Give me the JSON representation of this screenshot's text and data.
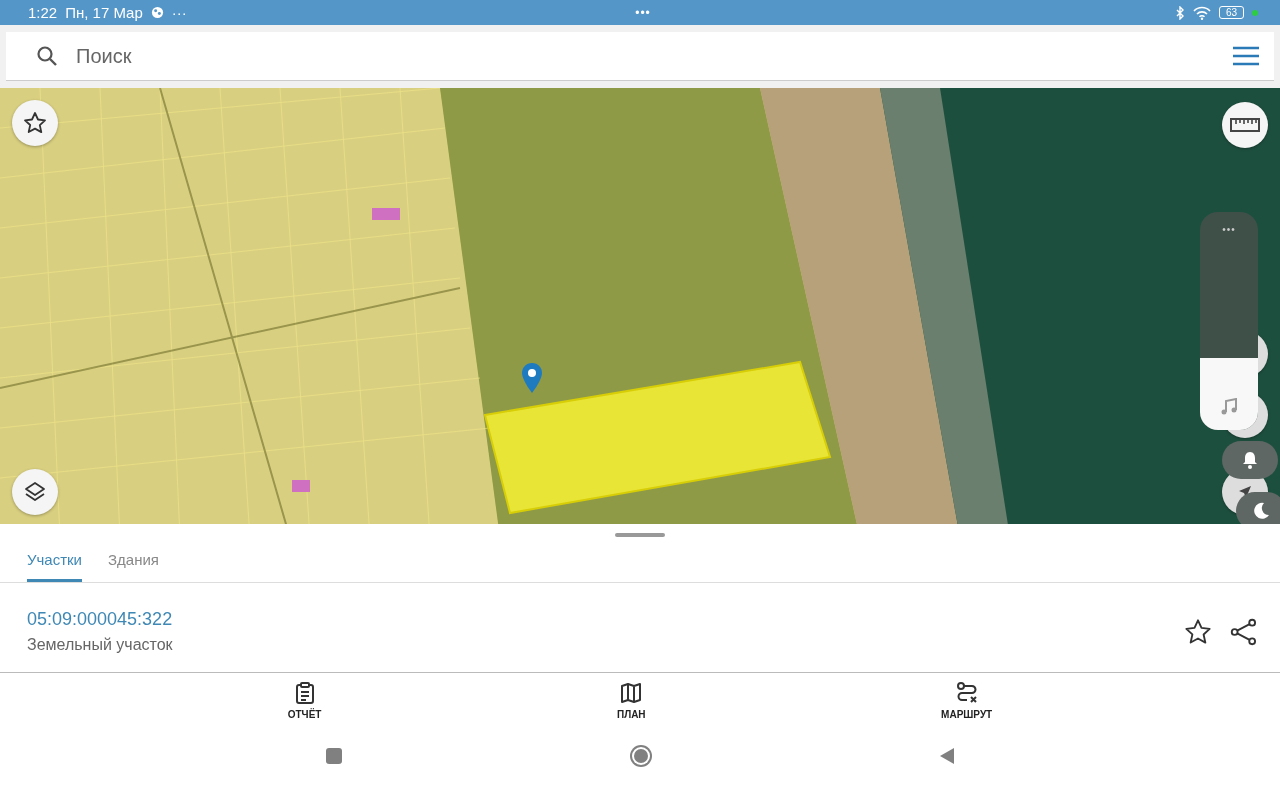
{
  "status_bar": {
    "time": "1:22",
    "date": "Пн, 17 Мар",
    "overflow": "···",
    "center": "•••",
    "battery": "63"
  },
  "search": {
    "placeholder": "Поиск"
  },
  "volume_panel": {
    "dots": "•••",
    "level": 0.33
  },
  "tabs": [
    {
      "label": "Участки",
      "selected": true
    },
    {
      "label": "Здания",
      "selected": false
    }
  ],
  "parcel": {
    "number": "05:09:000045:322",
    "type": "Земельный участок"
  },
  "bottom_nav": [
    {
      "kind": "report",
      "label": "ОТЧЁТ"
    },
    {
      "kind": "plan",
      "label": "ПЛАН"
    },
    {
      "kind": "route",
      "label": "МАРШРУТ"
    }
  ]
}
